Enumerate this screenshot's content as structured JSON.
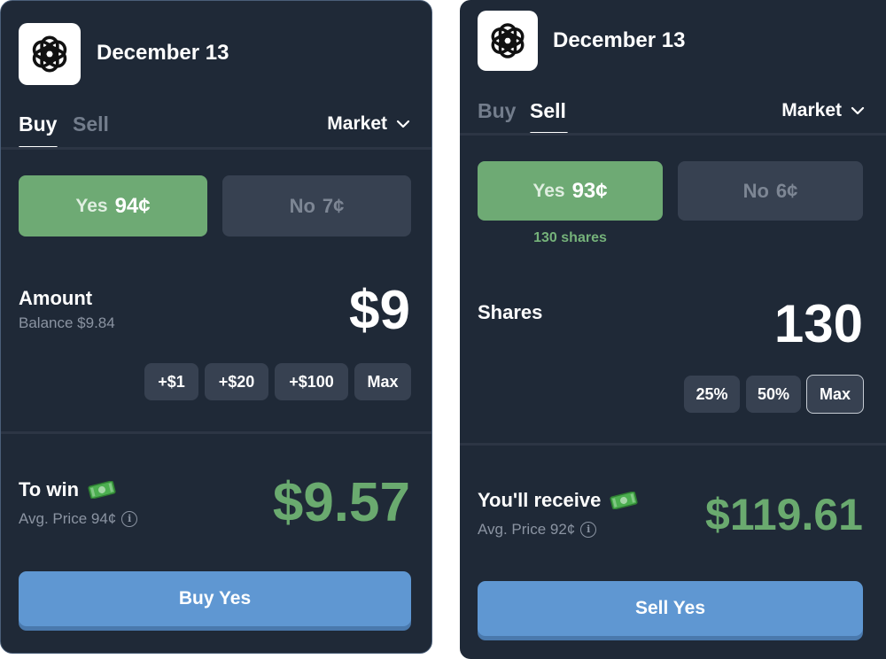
{
  "buy_panel": {
    "title": "December 13",
    "logo_icon": "openai-logo-icon",
    "tabs": [
      "Buy",
      "Sell"
    ],
    "active_tab": "Buy",
    "order_type": "Market",
    "yes": {
      "label": "Yes",
      "price": "94¢"
    },
    "no": {
      "label": "No",
      "price": "7¢"
    },
    "amount_label": "Amount",
    "balance": "Balance $9.84",
    "amount_value": "$9",
    "chips": [
      "+$1",
      "+$20",
      "+$100",
      "Max"
    ],
    "result_label": "To win",
    "avg_price": "Avg. Price 94¢",
    "result_value": "$9.57",
    "cta": "Buy Yes"
  },
  "sell_panel": {
    "title": "December 13",
    "logo_icon": "openai-logo-icon",
    "tabs": [
      "Buy",
      "Sell"
    ],
    "active_tab": "Sell",
    "order_type": "Market",
    "yes": {
      "label": "Yes",
      "price": "93¢"
    },
    "no": {
      "label": "No",
      "price": "6¢"
    },
    "shares_held": "130 shares",
    "shares_label": "Shares",
    "shares_value": "130",
    "chips": [
      "25%",
      "50%",
      "Max"
    ],
    "result_label": "You'll receive",
    "avg_price": "Avg. Price 92¢",
    "result_value": "$119.61",
    "cta": "Sell Yes"
  },
  "colors": {
    "panel_bg": "#1f2937",
    "yes_green": "#6eaa74",
    "no_gray": "#374151",
    "payout_green": "#6aaa6f",
    "cta_blue": "#5f97d2"
  }
}
